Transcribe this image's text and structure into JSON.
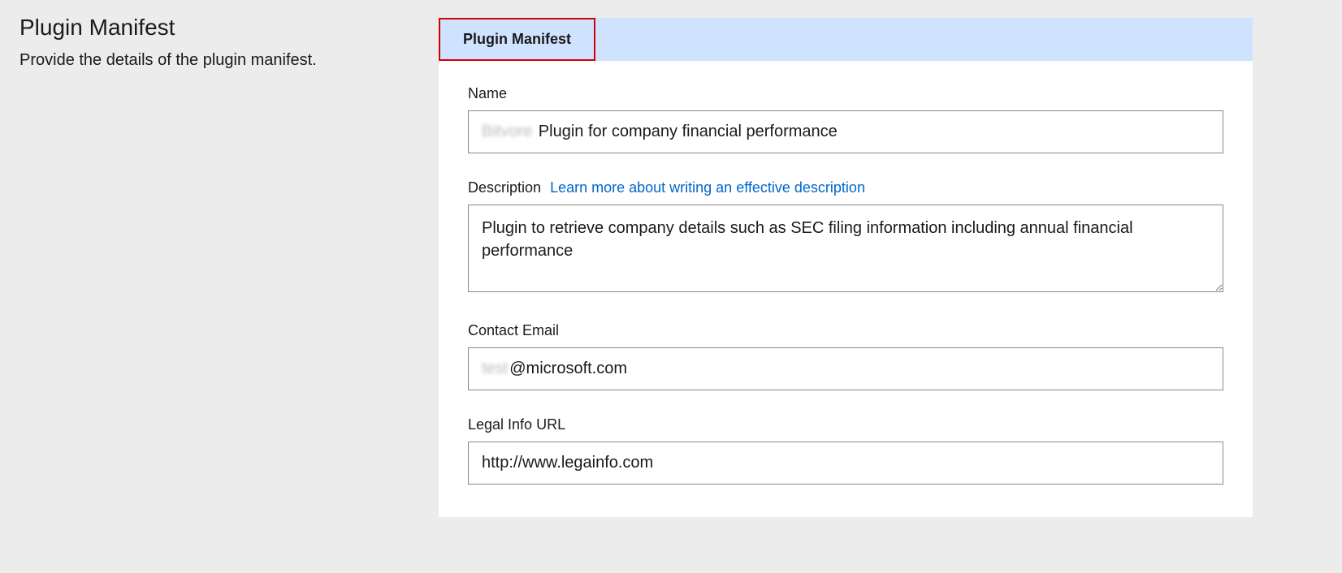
{
  "sidebar": {
    "title": "Plugin Manifest",
    "subtitle": "Provide the details of the plugin manifest."
  },
  "tab": {
    "label": "Plugin Manifest"
  },
  "form": {
    "name": {
      "label": "Name",
      "value_prefix": "Bitvore",
      "value_suffix": " Plugin for company financial performance"
    },
    "description": {
      "label": "Description",
      "link_text": "Learn more about writing an effective description",
      "value": "Plugin to retrieve company details such as SEC filing information including annual financial performance"
    },
    "contact_email": {
      "label": "Contact Email",
      "value_prefix": "test",
      "value_suffix": "@microsoft.com"
    },
    "legal_info_url": {
      "label": "Legal Info URL",
      "value": "http://www.legainfo.com"
    }
  }
}
